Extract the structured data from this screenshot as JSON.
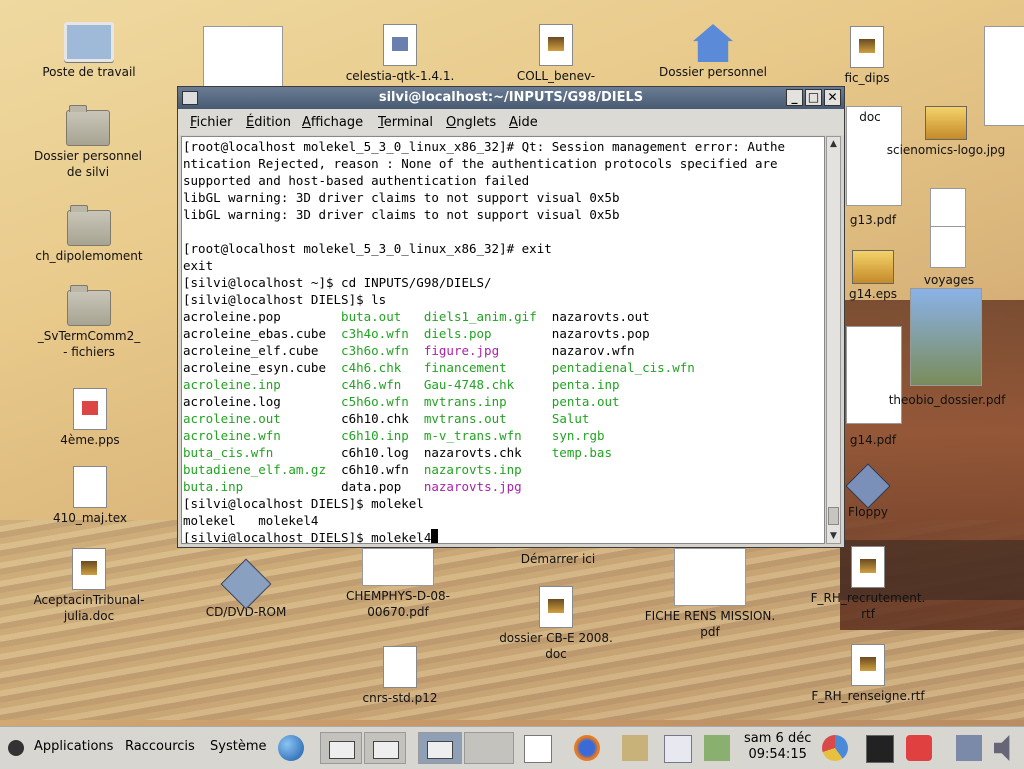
{
  "desktop": {
    "icons": [
      {
        "key": "poste",
        "label": "Poste de travail"
      },
      {
        "key": "dossier_silvi",
        "label": "Dossier personnel\nde silvi"
      },
      {
        "key": "ch_dipole",
        "label": "ch_dipolemoment"
      },
      {
        "key": "svterm",
        "label": "_SvTermComm2_\n- fichiers"
      },
      {
        "key": "pps",
        "label": "4ème.pps"
      },
      {
        "key": "maj",
        "label": "410_maj.tex"
      },
      {
        "key": "acept",
        "label": "AceptacinTribunal-\njulia.doc"
      },
      {
        "key": "cdrom",
        "label": "CD/DVD-ROM"
      },
      {
        "key": "chemphys",
        "label": "CHEMPHYS-D-08-\n00670.pdf"
      },
      {
        "key": "dossier_cb",
        "label": "dossier CB-E  2008.\ndoc"
      },
      {
        "key": "cnrs",
        "label": "cnrs-std.p12"
      },
      {
        "key": "fiche",
        "label": "FICHE RENS MISSION.\npdf"
      },
      {
        "key": "celestia",
        "label": "celestia-qtk-1.4.1."
      },
      {
        "key": "coll",
        "label": "COLL_benev-"
      },
      {
        "key": "dossier_perso",
        "label": "Dossier personnel"
      },
      {
        "key": "demarrer",
        "label": "Démarrer ici"
      },
      {
        "key": "floppy",
        "label": "Floppy"
      },
      {
        "key": "frh_recru",
        "label": "F_RH_recrutement.\nrtf"
      },
      {
        "key": "frh_rens",
        "label": "F_RH_renseigne.rtf"
      },
      {
        "key": "g13",
        "label": "g13.pdf"
      },
      {
        "key": "g14eps",
        "label": "g14.eps"
      },
      {
        "key": "g14pdf",
        "label": "g14.pdf"
      },
      {
        "key": "theobio",
        "label": "theobio_dossier.pdf"
      },
      {
        "key": "voyages",
        "label": "voyages"
      },
      {
        "key": "scienomics",
        "label": "scienomics-logo.jpg"
      },
      {
        "key": "floppy_frag",
        "label": "fic_dips"
      },
      {
        "key": "doc",
        "label": "doc"
      }
    ]
  },
  "window": {
    "title": "silvi@localhost:~/INPUTS/G98/DIELS",
    "buttons": {
      "minimize": "_",
      "maximize": "□",
      "close": "✕"
    },
    "menu": [
      "Fichier",
      "Édition",
      "Affichage",
      "Terminal",
      "Onglets",
      "Aide"
    ],
    "terminal_lines": [
      "[root@localhost molekel_5_3_0_linux_x86_32]# Qt: Session management error: Authe",
      "ntication Rejected, reason : None of the authentication protocols specified are",
      "supported and host-based authentication failed",
      "libGL warning: 3D driver claims to not support visual 0x5b",
      "libGL warning: 3D driver claims to not support visual 0x5b",
      "",
      "[root@localhost molekel_5_3_0_linux_x86_32]# exit",
      "exit",
      "[silvi@localhost ~]$ cd INPUTS/G98/DIELS/",
      "[silvi@localhost DIELS]$ ls"
    ],
    "ls_rows": [
      [
        [
          "acroleine.pop",
          ""
        ],
        [
          "buta.out",
          "g"
        ],
        [
          "diels1_anim.gif",
          "g"
        ],
        [
          "nazarovts.out",
          ""
        ]
      ],
      [
        [
          "acroleine_ebas.cube",
          ""
        ],
        [
          "c3h4o.wfn",
          "g"
        ],
        [
          "diels.pop",
          "g"
        ],
        [
          "nazarovts.pop",
          ""
        ]
      ],
      [
        [
          "acroleine_elf.cube",
          ""
        ],
        [
          "c3h6o.wfn",
          "g"
        ],
        [
          "figure.jpg",
          "m"
        ],
        [
          "nazarov.wfn",
          ""
        ]
      ],
      [
        [
          "acroleine_esyn.cube",
          ""
        ],
        [
          "c4h6.chk",
          "g"
        ],
        [
          "financement",
          "g"
        ],
        [
          "pentadienal_cis.wfn",
          "g"
        ]
      ],
      [
        [
          "acroleine.inp",
          "g"
        ],
        [
          "c4h6.wfn",
          "g"
        ],
        [
          "Gau-4748.chk",
          "g"
        ],
        [
          "penta.inp",
          "g"
        ]
      ],
      [
        [
          "acroleine.log",
          ""
        ],
        [
          "c5h6o.wfn",
          "g"
        ],
        [
          "mvtrans.inp",
          "g"
        ],
        [
          "penta.out",
          "g"
        ]
      ],
      [
        [
          "acroleine.out",
          "g"
        ],
        [
          "c6h10.chk",
          ""
        ],
        [
          "mvtrans.out",
          "g"
        ],
        [
          "Salut",
          "g"
        ]
      ],
      [
        [
          "acroleine.wfn",
          "g"
        ],
        [
          "c6h10.inp",
          "g"
        ],
        [
          "m-v_trans.wfn",
          "g"
        ],
        [
          "syn.rgb",
          "g"
        ]
      ],
      [
        [
          "buta_cis.wfn",
          "g"
        ],
        [
          "c6h10.log",
          ""
        ],
        [
          "nazarovts.chk",
          ""
        ],
        [
          "temp.bas",
          "g"
        ]
      ],
      [
        [
          "butadiene_elf.am.gz",
          "g"
        ],
        [
          "c6h10.wfn",
          ""
        ],
        [
          "nazarovts.inp",
          "g"
        ],
        [
          "",
          ""
        ]
      ],
      [
        [
          "buta.inp",
          "g"
        ],
        [
          "data.pop",
          ""
        ],
        [
          "nazarovts.jpg",
          "m"
        ],
        [
          "",
          ""
        ]
      ]
    ],
    "after_lines": [
      "[silvi@localhost DIELS]$ molekel",
      "molekel   molekel4"
    ],
    "prompt": "[silvi@localhost DIELS]$ molekel4"
  },
  "panel": {
    "menus": [
      "Applications",
      "Raccourcis",
      "Système"
    ],
    "clock_date": "sam  6 déc",
    "clock_time": "09:54:15"
  },
  "colors": {
    "green": "#22a322",
    "magenta": "#aa22aa",
    "titlebar": "#5a6c84"
  }
}
